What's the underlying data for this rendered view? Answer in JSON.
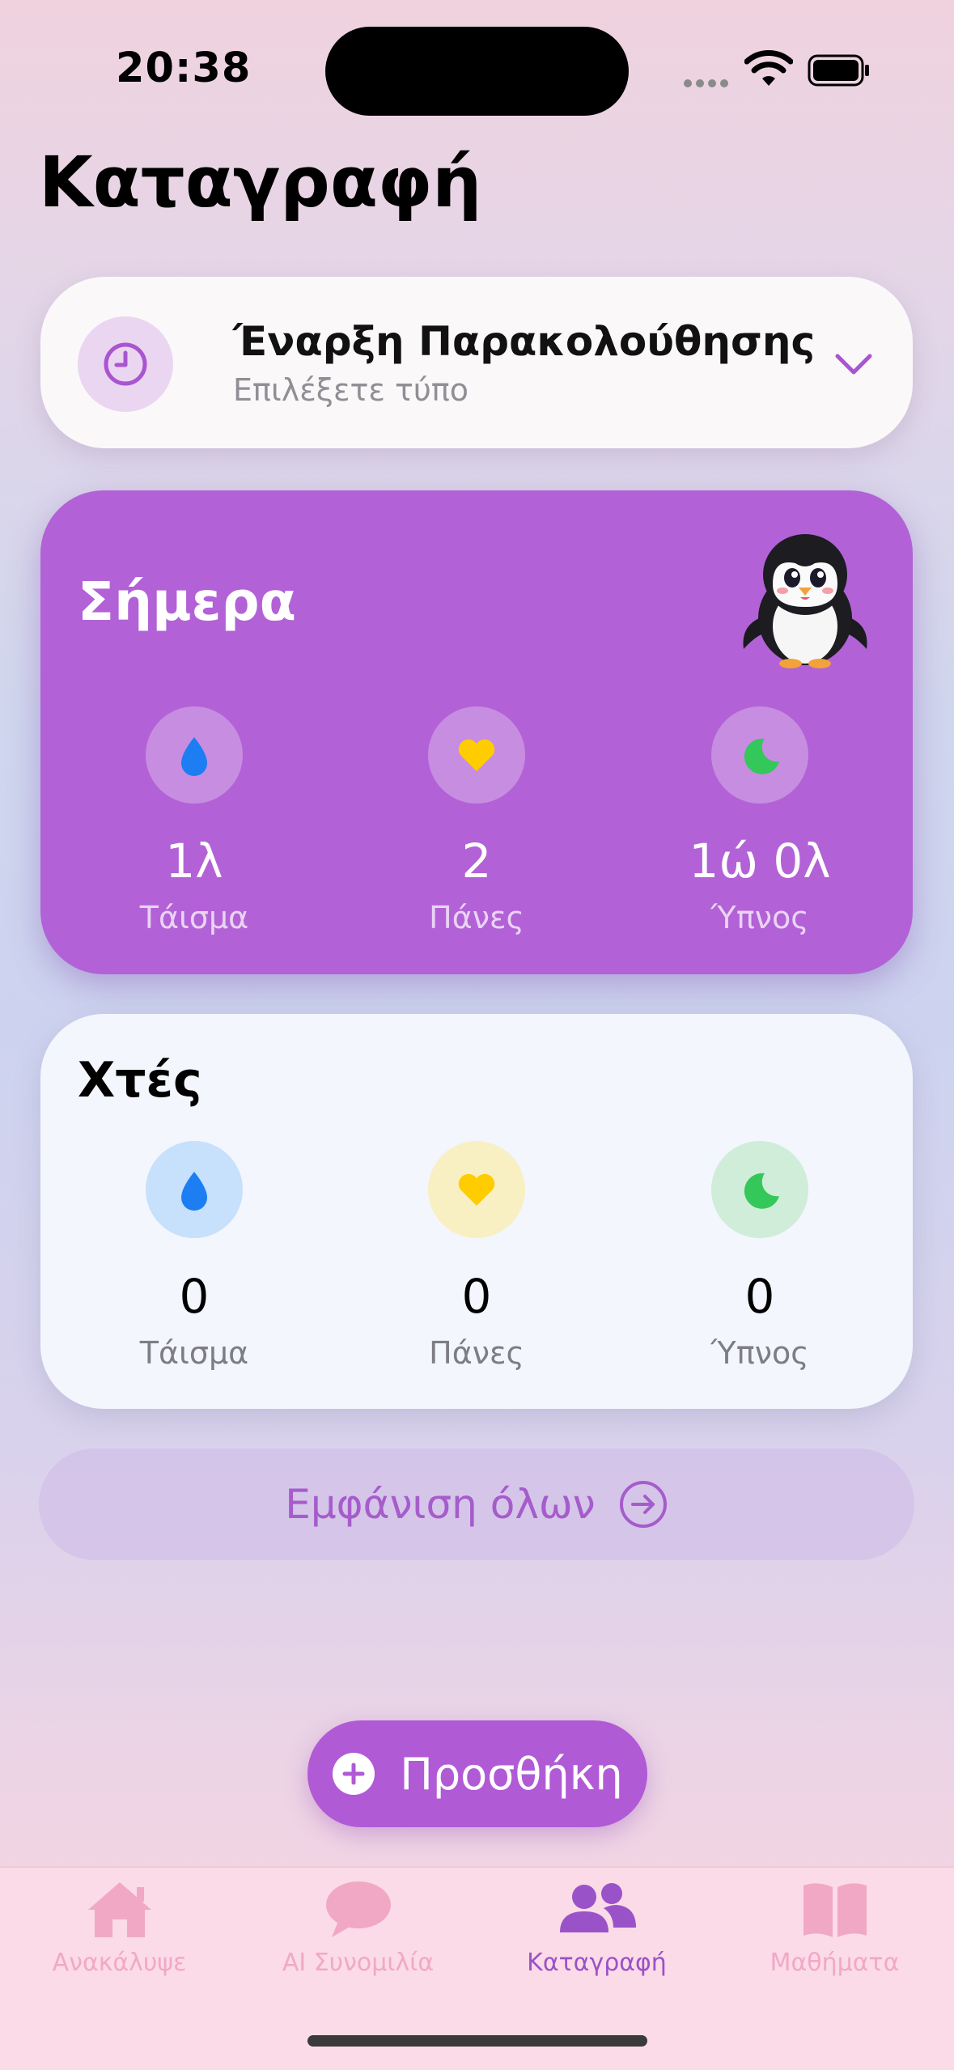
{
  "status_bar": {
    "time": "20:38"
  },
  "page_title": "Καταγραφή",
  "tracking": {
    "title": "Έναρξη Παρακολούθησης",
    "subtitle": "Επιλέξετε τύπο"
  },
  "today": {
    "title": "Σήμερα",
    "stats": [
      {
        "value": "1λ",
        "label": "Τάισμα",
        "icon": "drop-icon"
      },
      {
        "value": "2",
        "label": "Πάνες",
        "icon": "heart-icon"
      },
      {
        "value": "1ώ 0λ",
        "label": "Ύπνος",
        "icon": "moon-icon"
      }
    ]
  },
  "yesterday": {
    "title": "Χτές",
    "stats": [
      {
        "value": "0",
        "label": "Τάισμα",
        "icon": "drop-icon"
      },
      {
        "value": "0",
        "label": "Πάνες",
        "icon": "heart-icon"
      },
      {
        "value": "0",
        "label": "Ύπνος",
        "icon": "moon-icon"
      }
    ]
  },
  "show_all_label": "Εμφάνιση όλων",
  "add_label": "Προσθήκη",
  "tabs": [
    {
      "label": "Ανακάλυψε",
      "icon": "house-icon",
      "active": false
    },
    {
      "label": "AI Συνομιλία",
      "icon": "chat-bubble-icon",
      "active": false
    },
    {
      "label": "Καταγραφή",
      "icon": "people-icon",
      "active": true
    },
    {
      "label": "Μαθήματα",
      "icon": "book-icon",
      "active": false
    }
  ],
  "colors": {
    "accent": "#b262d6",
    "drop": "#1c7ef2",
    "heart": "#ffcc00",
    "moon": "#34c759",
    "tab_inactive": "#f1a8c5",
    "tab_active": "#9a52c9"
  }
}
